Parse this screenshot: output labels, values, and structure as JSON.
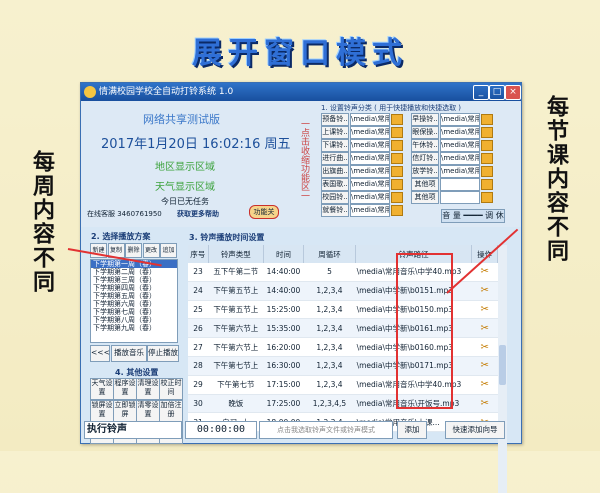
{
  "banner": "展开窗口模式",
  "annotations": {
    "left": "每周内容不同",
    "right": "每节课内容不同"
  },
  "window": {
    "title": "情满校园学校全自动打铃系统 1.0",
    "min": "_",
    "max": "□",
    "close": "×"
  },
  "info": {
    "version": "网络共享测试版",
    "datetime": "2017年1月20日  16:02:16  周五",
    "region": "地区显示区域",
    "weather": "天气显示区域",
    "today": "今日已无任务",
    "service": "在线客服 3460761950",
    "help": "获取更多帮助",
    "toggle": "功能关",
    "vertical": "一点击收缩功能区一"
  },
  "categories": {
    "header": "1. 设置铃声分类 ( 用于快捷播放和快捷选取 )",
    "left": [
      {
        "name": "预备铃..",
        "path": "\\media\\常用"
      },
      {
        "name": "上课铃..",
        "path": "\\media\\常用"
      },
      {
        "name": "下课铃..",
        "path": "\\media\\常用"
      },
      {
        "name": "进行曲..",
        "path": "\\media\\常用"
      },
      {
        "name": "出旗曲..",
        "path": "\\media\\常用"
      },
      {
        "name": "表国歌..",
        "path": "\\media\\常用"
      },
      {
        "name": "校园铃..",
        "path": "\\media\\常用"
      },
      {
        "name": "就餐铃..",
        "path": "\\media\\常用"
      }
    ],
    "right": [
      {
        "name": "早操铃..",
        "path": "\\media\\常用"
      },
      {
        "name": "眼保操..",
        "path": "\\media\\常用"
      },
      {
        "name": "午休铃..",
        "path": "\\media\\常用"
      },
      {
        "name": "信灯铃..",
        "path": "\\media\\常用"
      },
      {
        "name": "放学铃..",
        "path": "\\media\\常用"
      },
      {
        "name": "其他项1..",
        "path": ""
      },
      {
        "name": "其他项2..",
        "path": ""
      }
    ],
    "volume": "音 量 ━━━━ 调 休"
  },
  "plans": {
    "header": "2. 选择播放方案",
    "buttons": [
      "新建",
      "复制",
      "删除",
      "更改",
      "追加"
    ],
    "items": [
      "下学期第一周（春）",
      "下学期第二周（春）",
      "下学期第三周（春）",
      "下学期第四周（春）",
      "下学期第五周（春）",
      "下学期第六周（春）",
      "下学期第七周（春）",
      "下学期第八周（春）",
      "下学期第九周（春）"
    ],
    "prev": "<<<",
    "play": "播放音乐",
    "stop": "停止播放"
  },
  "other": {
    "header": "4. 其他设置",
    "buttons": [
      "天气设置",
      "程序设置",
      "清理设置",
      "校正时间",
      "锁屏设置",
      "立即锁屏",
      "清零设置",
      "加倍注册",
      "恢复初始",
      "备份当前",
      "恢复设置",
      "程序帮助"
    ]
  },
  "schedule": {
    "header": "3. 铃声播放时间设置",
    "columns": [
      "序号",
      "铃声类型",
      "时间",
      "周循环",
      "铃声路径",
      "操作"
    ],
    "rows": [
      {
        "no": "23",
        "type": "五下午第二节",
        "time": "14:40:00",
        "week": "5",
        "path": "\\media\\常用音乐\\中学40.mp3"
      },
      {
        "no": "24",
        "type": "下午第五节上",
        "time": "14:40:00",
        "week": "1,2,3,4",
        "path": "\\media\\中学新\\b0151.mp3"
      },
      {
        "no": "25",
        "type": "下午第五节上",
        "time": "15:25:00",
        "week": "1,2,3,4",
        "path": "\\media\\中学新\\b0150.mp3"
      },
      {
        "no": "26",
        "type": "下午第六节上",
        "time": "15:35:00",
        "week": "1,2,3,4",
        "path": "\\media\\中学新\\b0161.mp3"
      },
      {
        "no": "27",
        "type": "下午第六节上",
        "time": "16:20:00",
        "week": "1,2,3,4",
        "path": "\\media\\中学新\\b0160.mp3"
      },
      {
        "no": "28",
        "type": "下午第七节上",
        "time": "16:30:00",
        "week": "1,2,3,4",
        "path": "\\media\\中学新\\b0171.mp3"
      },
      {
        "no": "29",
        "type": "下午第七节",
        "time": "17:15:00",
        "week": "1,2,3,4",
        "path": "\\media\\常用音乐\\中学40.mp3"
      },
      {
        "no": "30",
        "type": "晚饭",
        "time": "17:25:00",
        "week": "1,2,3,4,5",
        "path": "\\media\\常用音乐\\开饭号.mp3"
      },
      {
        "no": "31",
        "type": "自习..上",
        "time": "18:00:00",
        "week": "1,2,3,4",
        "path": "\\media\\常用音乐\\上课..."
      }
    ]
  },
  "bottom": {
    "mode": "执行铃声",
    "time": "00:00:00",
    "hint": "点击我选取铃声文件或铃声模式",
    "add": "添加",
    "wizard": "快速添加向导"
  }
}
